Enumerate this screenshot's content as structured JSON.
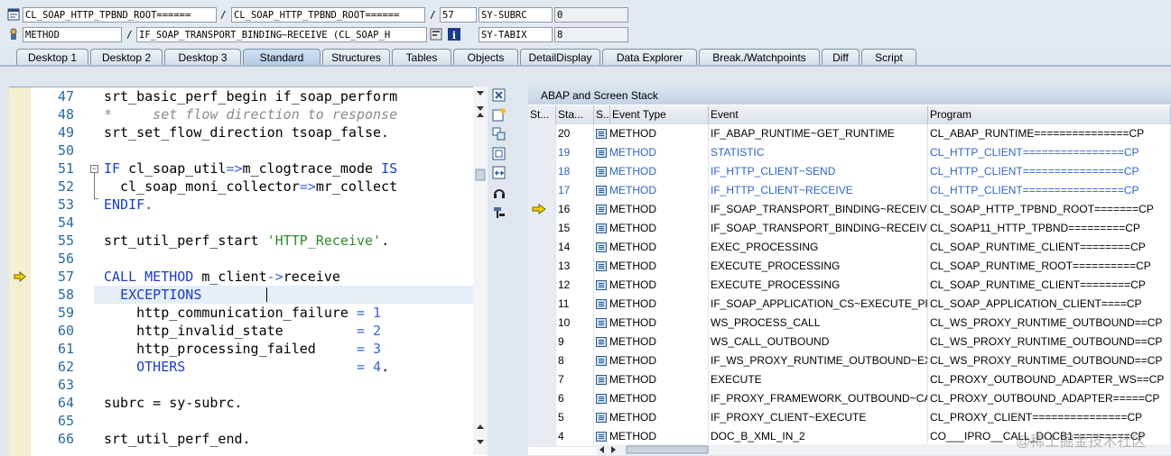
{
  "header": {
    "row1": {
      "program": "CL_SOAP_HTTP_TPBND_ROOT======",
      "include": "CL_SOAP_HTTP_TPBND_ROOT======",
      "line": "57",
      "sysvar": "SY-SUBRC",
      "sysvar_value": "0"
    },
    "row2": {
      "event_type": "METHOD",
      "event": "IF_SOAP_TRANSPORT_BINDING~RECEIVE (CL_SOAP_H",
      "sysvar": "SY-TABIX",
      "sysvar_value": "8"
    },
    "slash": "/"
  },
  "tabs": [
    "Desktop 1",
    "Desktop 2",
    "Desktop 3",
    "Standard",
    "Structures",
    "Tables",
    "Objects",
    "DetailDisplay",
    "Data Explorer",
    "Break./Watchpoints",
    "Diff",
    "Script"
  ],
  "active_tab": "Standard",
  "editor": {
    "lines": [
      {
        "n": "47",
        "t": "srt_basic_perf_begin if_soap_perform"
      },
      {
        "n": "48",
        "t": "*     set flow direction to response"
      },
      {
        "n": "49",
        "t": "srt_set_flow_direction tsoap_false."
      },
      {
        "n": "50",
        "t": ""
      },
      {
        "n": "51",
        "t": "IF cl_soap_util=>m_clogtrace_mode IS"
      },
      {
        "n": "52",
        "t": "  cl_soap_moni_collector=>mr_collect"
      },
      {
        "n": "53",
        "t": "ENDIF."
      },
      {
        "n": "54",
        "t": ""
      },
      {
        "n": "55",
        "t": "srt_util_perf_start 'HTTP_Receive'."
      },
      {
        "n": "56",
        "t": ""
      },
      {
        "n": "57",
        "t": "CALL METHOD m_client->receive"
      },
      {
        "n": "58",
        "t": "  EXCEPTIONS"
      },
      {
        "n": "59",
        "t": "    http_communication_failure = 1"
      },
      {
        "n": "60",
        "t": "    http_invalid_state         = 2"
      },
      {
        "n": "61",
        "t": "    http_processing_failed     = 3"
      },
      {
        "n": "62",
        "t": "    OTHERS                     = 4."
      },
      {
        "n": "63",
        "t": ""
      },
      {
        "n": "64",
        "t": "subrc = sy-subrc."
      },
      {
        "n": "65",
        "t": ""
      },
      {
        "n": "66",
        "t": "srt_util_perf_end."
      }
    ]
  },
  "stack": {
    "title": "ABAP and Screen Stack",
    "columns": [
      "St...",
      "Sta...",
      "S...",
      "Event Type",
      "Event",
      "Program"
    ],
    "rows": [
      {
        "lvl": "20",
        "type": "METHOD",
        "event": "IF_ABAP_RUNTIME~GET_RUNTIME",
        "program": "CL_ABAP_RUNTIME===============CP",
        "hl": false,
        "cur": false
      },
      {
        "lvl": "19",
        "type": "METHOD",
        "event": "STATISTIC",
        "program": "CL_HTTP_CLIENT================CP",
        "hl": true,
        "cur": false
      },
      {
        "lvl": "18",
        "type": "METHOD",
        "event": "IF_HTTP_CLIENT~SEND",
        "program": "CL_HTTP_CLIENT================CP",
        "hl": true,
        "cur": false
      },
      {
        "lvl": "17",
        "type": "METHOD",
        "event": "IF_HTTP_CLIENT~RECEIVE",
        "program": "CL_HTTP_CLIENT================CP",
        "hl": true,
        "cur": false
      },
      {
        "lvl": "16",
        "type": "METHOD",
        "event": "IF_SOAP_TRANSPORT_BINDING~RECEIVE",
        "program": "CL_SOAP_HTTP_TPBND_ROOT=======CP",
        "hl": false,
        "cur": true
      },
      {
        "lvl": "15",
        "type": "METHOD",
        "event": "IF_SOAP_TRANSPORT_BINDING~RECEIVE",
        "program": "CL_SOAP11_HTTP_TPBND=========CP",
        "hl": false,
        "cur": false
      },
      {
        "lvl": "14",
        "type": "METHOD",
        "event": "EXEC_PROCESSING",
        "program": "CL_SOAP_RUNTIME_CLIENT========CP",
        "hl": false,
        "cur": false
      },
      {
        "lvl": "13",
        "type": "METHOD",
        "event": "EXECUTE_PROCESSING",
        "program": "CL_SOAP_RUNTIME_ROOT==========CP",
        "hl": false,
        "cur": false
      },
      {
        "lvl": "12",
        "type": "METHOD",
        "event": "EXECUTE_PROCESSING",
        "program": "CL_SOAP_RUNTIME_CLIENT========CP",
        "hl": false,
        "cur": false
      },
      {
        "lvl": "11",
        "type": "METHOD",
        "event": "IF_SOAP_APPLICATION_CS~EXECUTE_PR...",
        "program": "CL_SOAP_APPLICATION_CLIENT====CP",
        "hl": false,
        "cur": false
      },
      {
        "lvl": "10",
        "type": "METHOD",
        "event": "WS_PROCESS_CALL",
        "program": "CL_WS_PROXY_RUNTIME_OUTBOUND==CP",
        "hl": false,
        "cur": false
      },
      {
        "lvl": "9",
        "type": "METHOD",
        "event": "WS_CALL_OUTBOUND",
        "program": "CL_WS_PROXY_RUNTIME_OUTBOUND==CP",
        "hl": false,
        "cur": false
      },
      {
        "lvl": "8",
        "type": "METHOD",
        "event": "IF_WS_PROXY_RUNTIME_OUTBOUND~EX...",
        "program": "CL_WS_PROXY_RUNTIME_OUTBOUND==CP",
        "hl": false,
        "cur": false
      },
      {
        "lvl": "7",
        "type": "METHOD",
        "event": "EXECUTE",
        "program": "CL_PROXY_OUTBOUND_ADAPTER_WS==CP",
        "hl": false,
        "cur": false
      },
      {
        "lvl": "6",
        "type": "METHOD",
        "event": "IF_PROXY_FRAMEWORK_OUTBOUND~CAL...",
        "program": "CL_PROXY_OUTBOUND_ADAPTER=====CP",
        "hl": false,
        "cur": false
      },
      {
        "lvl": "5",
        "type": "METHOD",
        "event": "IF_PROXY_CLIENT~EXECUTE",
        "program": "CL_PROXY_CLIENT===============CP",
        "hl": false,
        "cur": false
      },
      {
        "lvl": "4",
        "type": "METHOD",
        "event": "DOC_B_XML_IN_2",
        "program": "CO___IPRO__CALL_DOCB1=========CP",
        "hl": false,
        "cur": false
      }
    ]
  },
  "watermark": "@稀土掘金技术社区",
  "colors": {
    "keyword": "#1a3cc6",
    "comment": "#8a8a8a",
    "string": "#2e8b2e",
    "highlight_row": "#2f63c4"
  }
}
